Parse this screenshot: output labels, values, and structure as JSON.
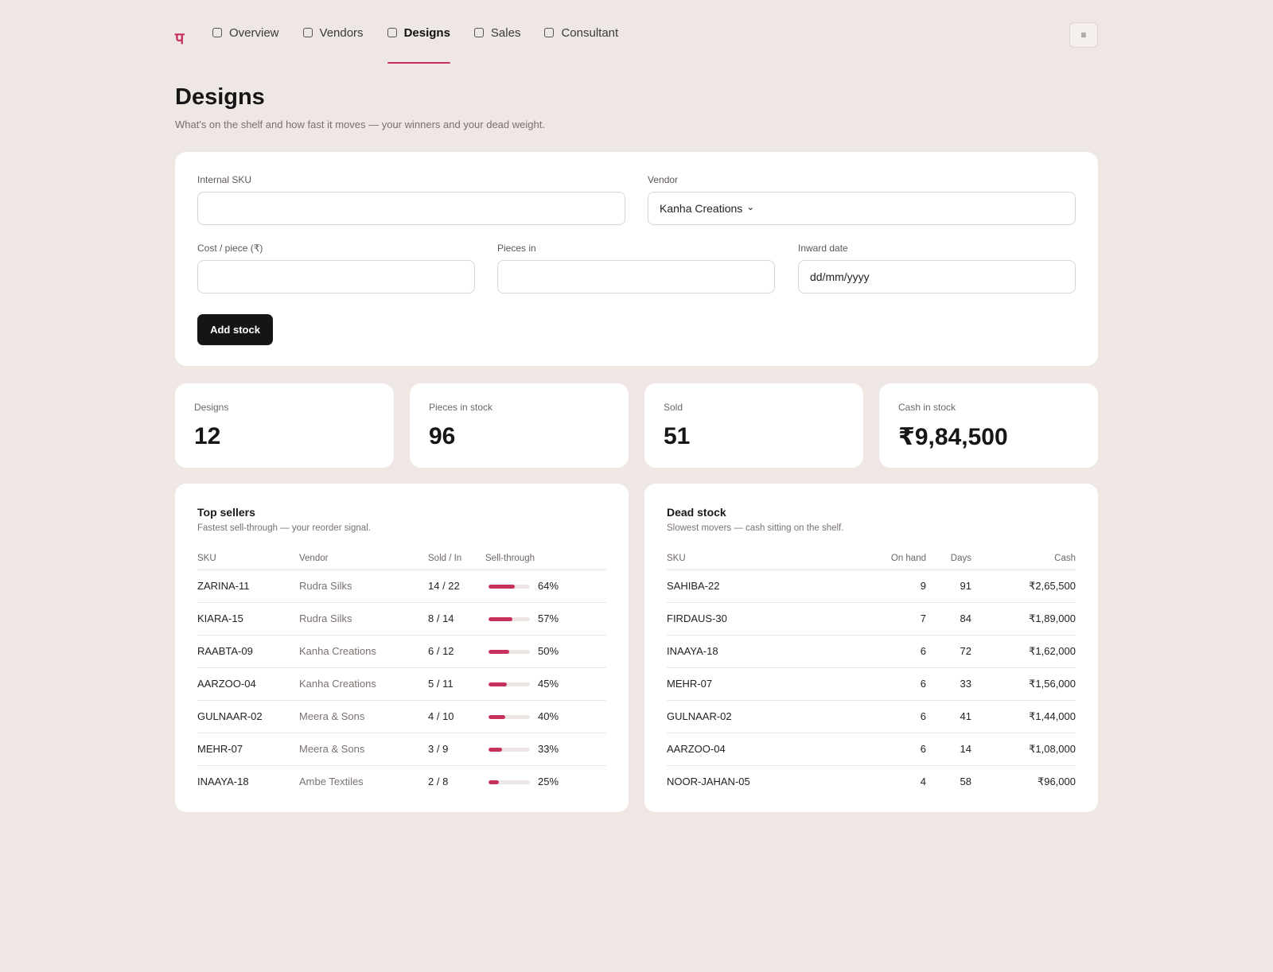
{
  "nav": {
    "logo": "प",
    "tabs": [
      {
        "label": "Overview",
        "active": false
      },
      {
        "label": "Vendors",
        "active": false
      },
      {
        "label": "Designs",
        "active": true
      },
      {
        "label": "Sales",
        "active": false
      },
      {
        "label": "Consultant",
        "active": false
      }
    ],
    "menu_icon": "≡"
  },
  "page": {
    "title": "Designs",
    "subtitle": "What's on the shelf and how fast it moves — your winners and your dead weight."
  },
  "form": {
    "internal_sku": {
      "label": "Internal SKU",
      "value": ""
    },
    "vendor": {
      "label": "Vendor",
      "value": "Kanha Creations",
      "chevron": "⌄"
    },
    "cost": {
      "label": "Cost / piece (₹)",
      "value": ""
    },
    "pieces": {
      "label": "Pieces in",
      "value": ""
    },
    "inward_date": {
      "label": "Inward date",
      "value": "dd/mm/yyyy"
    },
    "submit_label": "Add stock"
  },
  "stats": [
    {
      "label": "Designs",
      "value": "12"
    },
    {
      "label": "Pieces in stock",
      "value": "96"
    },
    {
      "label": "Sold",
      "value": "51"
    },
    {
      "label": "Cash in stock",
      "value": "₹9,84,500"
    }
  ],
  "top_sellers": {
    "title": "Top sellers",
    "subtitle": "Fastest sell-through — your reorder signal.",
    "columns": [
      "SKU",
      "Vendor",
      "Sold / In",
      "Sell-through"
    ],
    "rows": [
      {
        "sku": "ZARINA-11",
        "vendor": "Rudra Silks",
        "sold_in": "14 / 22",
        "pct_label": "64%",
        "pct": 64
      },
      {
        "sku": "KIARA-15",
        "vendor": "Rudra Silks",
        "sold_in": "8 / 14",
        "pct_label": "57%",
        "pct": 57
      },
      {
        "sku": "RAABTA-09",
        "vendor": "Kanha Creations",
        "sold_in": "6 / 12",
        "pct_label": "50%",
        "pct": 50
      },
      {
        "sku": "AARZOO-04",
        "vendor": "Kanha Creations",
        "sold_in": "5 / 11",
        "pct_label": "45%",
        "pct": 45
      },
      {
        "sku": "GULNAAR-02",
        "vendor": "Meera & Sons",
        "sold_in": "4 / 10",
        "pct_label": "40%",
        "pct": 40
      },
      {
        "sku": "MEHR-07",
        "vendor": "Meera & Sons",
        "sold_in": "3 / 9",
        "pct_label": "33%",
        "pct": 33
      },
      {
        "sku": "INAAYA-18",
        "vendor": "Ambe Textiles",
        "sold_in": "2 / 8",
        "pct_label": "25%",
        "pct": 25
      }
    ]
  },
  "dead_stock": {
    "title": "Dead stock",
    "subtitle": "Slowest movers — cash sitting on the shelf.",
    "columns": [
      "SKU",
      "On hand",
      "Days",
      "Cash"
    ],
    "rows": [
      {
        "sku": "SAHIBA-22",
        "on_hand": "9",
        "days": "91",
        "cash": "₹2,65,500"
      },
      {
        "sku": "FIRDAUS-30",
        "on_hand": "7",
        "days": "84",
        "cash": "₹1,89,000"
      },
      {
        "sku": "INAAYA-18",
        "on_hand": "6",
        "days": "72",
        "cash": "₹1,62,000"
      },
      {
        "sku": "MEHR-07",
        "on_hand": "6",
        "days": "33",
        "cash": "₹1,56,000"
      },
      {
        "sku": "GULNAAR-02",
        "on_hand": "6",
        "days": "41",
        "cash": "₹1,44,000"
      },
      {
        "sku": "AARZOO-04",
        "on_hand": "6",
        "days": "14",
        "cash": "₹1,08,000"
      },
      {
        "sku": "NOOR-JAHAN-05",
        "on_hand": "4",
        "days": "58",
        "cash": "₹96,000"
      }
    ]
  },
  "colors": {
    "accent": "#c8305c",
    "background": "#efe7e4",
    "button": "#151515"
  }
}
